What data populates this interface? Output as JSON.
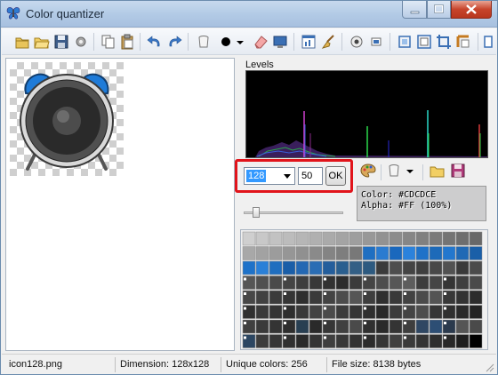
{
  "window": {
    "title": "Color quantizer"
  },
  "levels": {
    "label": "Levels"
  },
  "quantize": {
    "colors_value": "128",
    "second_value": "50",
    "ok_label": "OK",
    "slider_level": 0.1
  },
  "color_info": {
    "color_line": "Color: #CDCDCE",
    "alpha_line": "Alpha: #FF (100%)"
  },
  "palette": {
    "rows": [
      [
        "#cfcfcf",
        "#c8c8c8",
        "#c2c2c2",
        "#bcbcbc",
        "#b6b6b6",
        "#b0b0b0",
        "#aaaaaa",
        "#a4a4a4",
        "#9e9e9e",
        "#989898",
        "#929292",
        "#8c8c8c",
        "#868686",
        "#808080",
        "#7a7a7a",
        "#747474",
        "#6e6e6e",
        "#686868"
      ],
      [
        "#a8a8a8",
        "#a2a2a2",
        "#9c9c9c",
        "#969696",
        "#909090",
        "#8a8a8a",
        "#848484",
        "#7e7e7e",
        "#787878",
        "#1f6fc2",
        "#2a7bd0",
        "#1a68bd",
        "#2b82dc",
        "#1f72c8",
        "#1d6ab9",
        "#2377ce",
        "#2069b5",
        "#1a5fa8"
      ],
      [
        "#1e72c9",
        "#2a80d8",
        "#1f6ebf",
        "#1a5ea8",
        "#2468b3",
        "#2a6db4",
        "#245e9c",
        "#2a5f8f",
        "#335f85",
        "#2d5a80",
        "#3b3b3b",
        "#4e4e4e",
        "#444444",
        "#3f3f3f",
        "#484848",
        "#525252",
        "#3a3a3a",
        "#4b4b4b"
      ],
      [
        "#565656",
        "#505050",
        "#4a4a4a",
        "#444444",
        "#3e3e3e",
        "#383838",
        "#323232",
        "#2c2c2c",
        "#3b3b3b",
        "#444444",
        "#4d4d4d",
        "#575757",
        "#5d5d5d",
        "#3d3d3d",
        "#454545",
        "#353535",
        "#3f3f3f",
        "#4a4a4a"
      ],
      [
        "#474747",
        "#414141",
        "#3b3b3b",
        "#353535",
        "#2f2f2f",
        "#3a3a3a",
        "#434343",
        "#4c4c4c",
        "#555555",
        "#3e3e3e",
        "#2f2f2f",
        "#393939",
        "#424242",
        "#4b4b4b",
        "#545454",
        "#383838",
        "#333333",
        "#2d2d2d"
      ],
      [
        "#303030",
        "#3a3a3a",
        "#343434",
        "#2e2e2e",
        "#393939",
        "#424242",
        "#4b4b4b",
        "#3c3c3c",
        "#353535",
        "#2f2f2f",
        "#292929",
        "#3b3b3b",
        "#444444",
        "#4d4d4d",
        "#363636",
        "#303030",
        "#2a2a2a",
        "#242424"
      ],
      [
        "#404040",
        "#3a3a3a",
        "#343434",
        "#2e2e2e",
        "#283f52",
        "#2a2a2a",
        "#363636",
        "#404040",
        "#4a4a4a",
        "#303030",
        "#2a2a2a",
        "#343434",
        "#3e3e3e",
        "#2f4763",
        "#2d4e74",
        "#2b3a4d",
        "#555555",
        "#4a4a4a"
      ],
      [
        "#2b4662",
        "#3c3c3c",
        "#363636",
        "#303030",
        "#2a2a2a",
        "#343434",
        "#3e3e3e",
        "#383838",
        "#323232",
        "#2c2c2c",
        "#363636",
        "#404040",
        "#3a3a3a",
        "#343434",
        "#2e2e2e",
        "#282828",
        "#1e1e1e",
        "#000000"
      ]
    ]
  },
  "status": {
    "filename": "icon128.png",
    "dimension": "Dimension: 128x128",
    "unique_colors": "Unique colors: 256",
    "file_size": "File size: 8138 bytes"
  }
}
